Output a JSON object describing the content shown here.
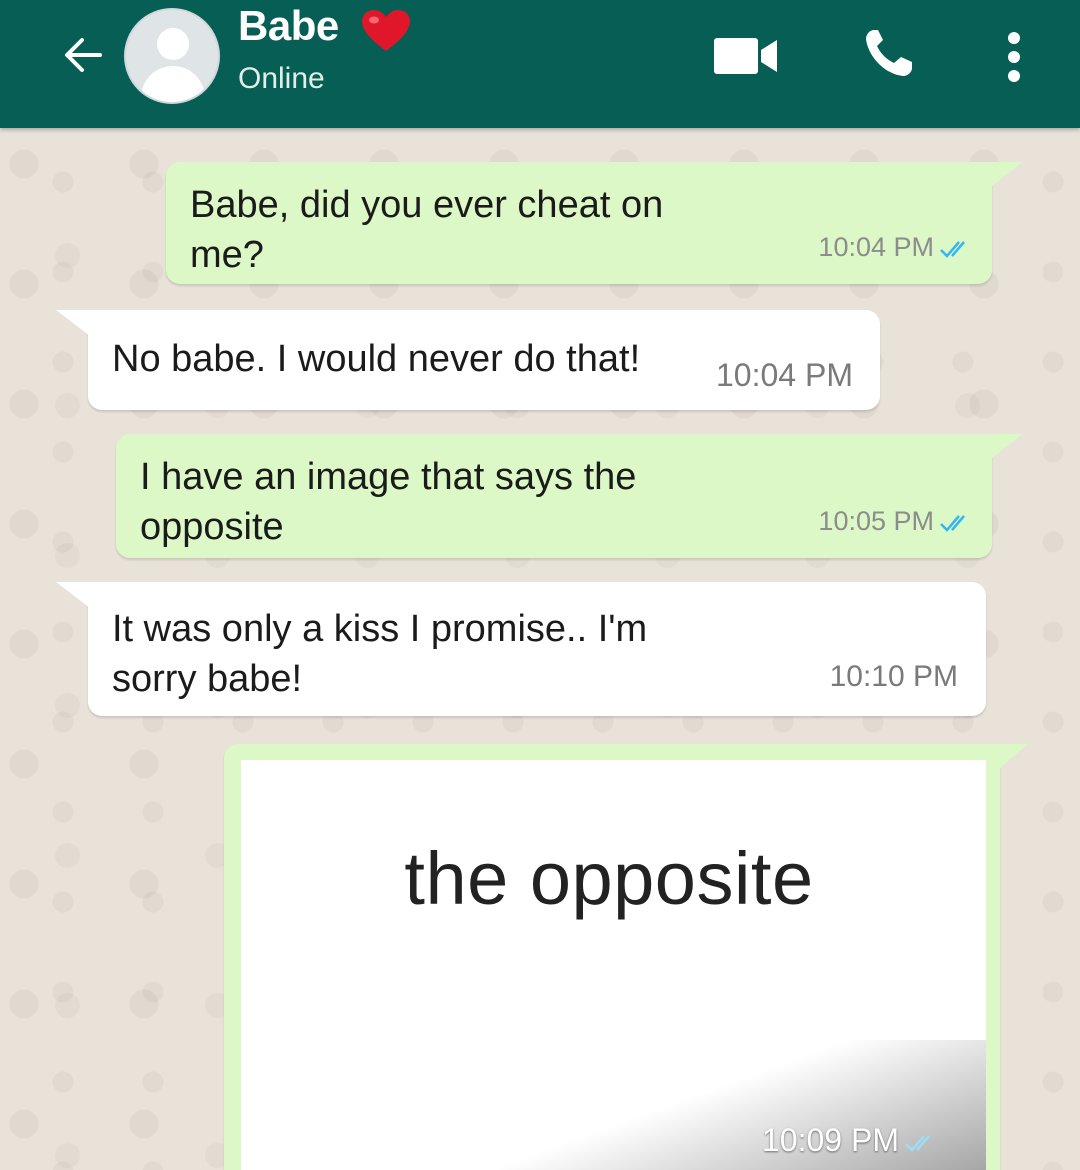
{
  "header": {
    "contact_name": "Babe",
    "status": "Online",
    "back_icon": "arrow-left-icon",
    "avatar_icon": "default-avatar-icon",
    "name_emoji": "red-heart-icon",
    "actions": [
      {
        "icon": "video-call-icon"
      },
      {
        "icon": "phone-call-icon"
      },
      {
        "icon": "more-vert-icon"
      }
    ]
  },
  "colors": {
    "header_bg": "#075e54",
    "outgoing_bubble": "#dcf8c6",
    "incoming_bubble": "#ffffff",
    "read_ticks": "#34b7f1",
    "wallpaper": "#e9e2d9"
  },
  "messages": [
    {
      "direction": "outgoing",
      "text": "Babe, did you ever cheat on\nme?",
      "time": "10:04 PM",
      "read_icon": "double-check-icon"
    },
    {
      "direction": "incoming",
      "text": "No babe. I would never do that!",
      "time": "10:04 PM"
    },
    {
      "direction": "outgoing",
      "text": "I have an image that says the\nopposite",
      "time": "10:05 PM",
      "read_icon": "double-check-icon"
    },
    {
      "direction": "incoming",
      "text": "It was only a kiss I promise.. I'm\nsorry babe!",
      "time": "10:10 PM"
    },
    {
      "direction": "outgoing",
      "type": "image",
      "image_text": "the opposite",
      "time": "10:09 PM",
      "read_icon": "double-check-icon"
    }
  ]
}
